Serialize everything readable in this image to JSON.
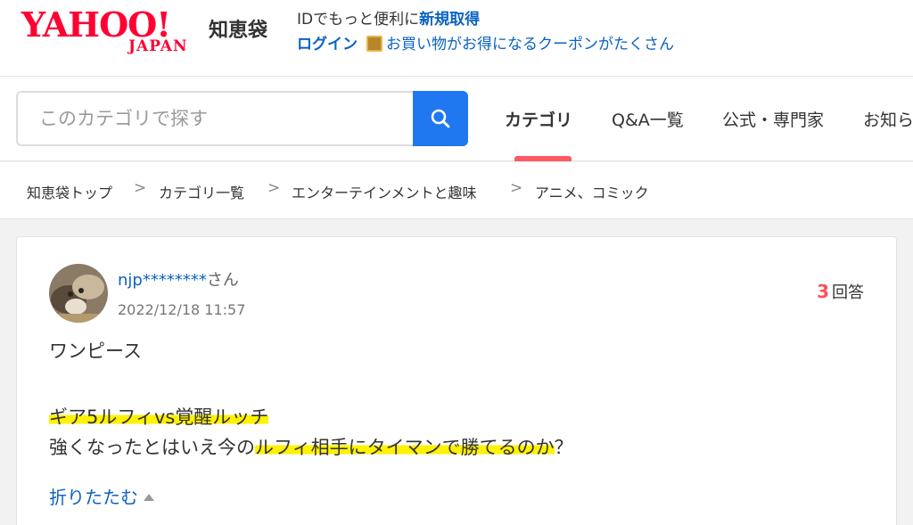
{
  "header": {
    "logo_yahoo": "YAHOO!",
    "logo_japan": "JAPAN",
    "logo_service": "知恵袋",
    "promo_text": "IDでもっと便利に",
    "promo_signup": "新規取得",
    "login": "ログイン",
    "coupon_text": "お買い物がお得になるクーポンがたくさん"
  },
  "search": {
    "placeholder": "このカテゴリで探す"
  },
  "nav": {
    "tabs": [
      {
        "label": "カテゴリ",
        "active": true
      },
      {
        "label": "Q&A一覧"
      },
      {
        "label": "公式・専門家"
      },
      {
        "label": "お知ら"
      }
    ]
  },
  "breadcrumb": {
    "items": [
      "知恵袋トップ",
      "カテゴリ一覧",
      "エンターテインメントと趣味",
      "アニメ、コミック"
    ],
    "separator": ">"
  },
  "question": {
    "user": "njp********",
    "user_suffix": "さん",
    "timestamp": "2022/12/18 11:57",
    "answer_count": "3",
    "answer_label": "回答",
    "title": "ワンピース",
    "line1": "ギア5ルフィvs覚醒ルッチ",
    "line2_prefix": "強くなったとはいえ今の",
    "line2_highlight": "ルフィ相手にタイマンで勝てるのか",
    "line2_suffix": "？",
    "collapse": "折りたたむ"
  },
  "colors": {
    "brand_red": "#ff0033",
    "link_blue": "#0b63c2",
    "search_blue": "#1f78f0",
    "tab_indicator": "#ff5a63",
    "highlight": "#fff200"
  }
}
